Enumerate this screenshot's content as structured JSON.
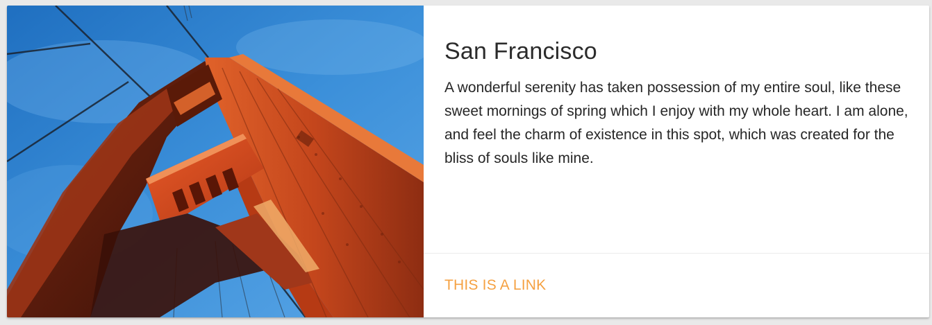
{
  "card": {
    "image_subject": "golden-gate-bridge-tower",
    "title": "San Francisco",
    "text": "A wonderful serenity has taken possession of my entire soul, like these sweet mornings of spring which I enjoy with my whole heart. I am alone, and feel the charm of existence in this spot, which was created for the bliss of souls like mine.",
    "link_label": "THIS IS A LINK"
  },
  "colors": {
    "link": "#f5a142",
    "sky": "#2f86d4",
    "tower": "#c0451c"
  }
}
